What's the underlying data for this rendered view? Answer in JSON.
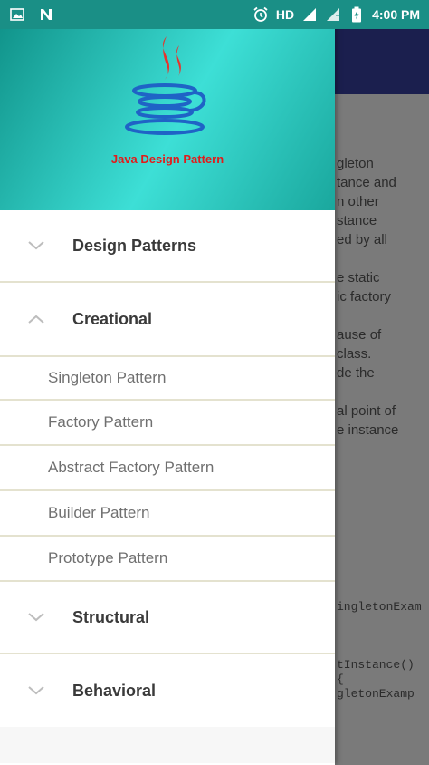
{
  "status_bar": {
    "network_label": "HD",
    "time": "4:00 PM"
  },
  "drawer": {
    "header_title": "Java Design Pattern",
    "groups": [
      {
        "label": "Design Patterns",
        "expanded": false
      },
      {
        "label": "Creational",
        "expanded": true
      },
      {
        "label": "Structural",
        "expanded": false
      },
      {
        "label": "Behavioral",
        "expanded": false
      }
    ],
    "creational_children": [
      "Singleton Pattern",
      "Factory Pattern",
      "Abstract Factory Pattern",
      "Builder Pattern",
      "Prototype Pattern"
    ]
  },
  "background_content": {
    "paragraph_lines": [
      "gleton",
      "tance and",
      "n other",
      "stance",
      "ed by all",
      "",
      "e static",
      "ic factory",
      "",
      "ause of",
      "class.",
      "de the",
      "",
      "al point of",
      "e instance"
    ],
    "code_lines": [
      "ingletonExam",
      "",
      "",
      "",
      "tInstance()",
      "{",
      "gletonExamp"
    ]
  },
  "colors": {
    "status_bar": "#1a8f86",
    "header_gradient_mid": "#3ddfd6",
    "caption": "#e21b1b",
    "app_bar_behind": "#1b1f4e"
  }
}
